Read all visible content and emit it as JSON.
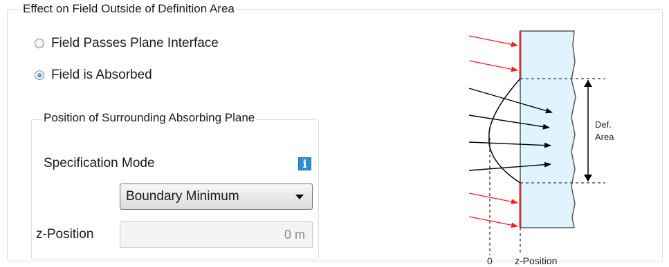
{
  "group": {
    "title": "Effect on Field Outside of Definition Area"
  },
  "radio_options": [
    {
      "label": "Field Passes Plane Interface",
      "selected": false
    },
    {
      "label": "Field is Absorbed",
      "selected": true
    }
  ],
  "absorbing_plane": {
    "title": "Position of Surrounding Absorbing Plane",
    "spec_mode_label": "Specification Mode",
    "info_icon": "info-icon",
    "dropdown_value": "Boundary Minimum",
    "z_label": "z-Position",
    "z_value": "0 m"
  },
  "diagram": {
    "def_area_line1": "Def.",
    "def_area_line2": "Area",
    "zero_label": "0",
    "z_label": "z-Position",
    "colors": {
      "region_fill": "#dff4fd",
      "absorber": "#d32f2f",
      "arrow_red": "#ff1a1a"
    }
  }
}
